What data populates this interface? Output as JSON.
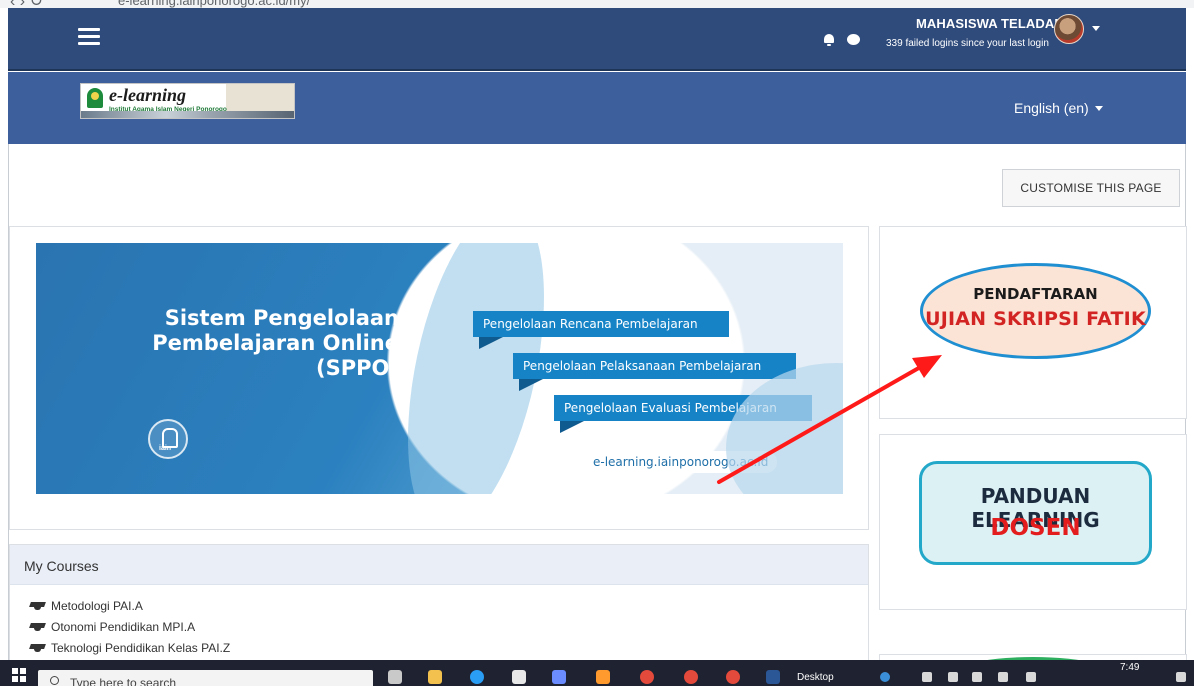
{
  "browser": {
    "url": "e-learning.iainponorogo.ac.id/my/"
  },
  "navbar": {
    "user_name": "MAHASISWA TELADAN",
    "failed_logins": "339 failed logins since your last login"
  },
  "header": {
    "logo_title": "e-learning",
    "logo_subtitle": "Institut Agama Islam Negeri Ponorogo",
    "language": "English (en)"
  },
  "page": {
    "customise_label": "CUSTOMISE THIS PAGE"
  },
  "banner": {
    "title_lines": [
      "Sistem Pengelolaan",
      "Pembelajaran Online",
      "(SPPO)"
    ],
    "tags": [
      "Pengelolaan Rencana Pembelajaran",
      "Pengelolaan Pelaksanaan Pembelajaran",
      "Pengelolaan Evaluasi Pembelajaran"
    ],
    "url": "e-learning.iainponorogo.ac.id"
  },
  "courses": {
    "heading": "My Courses",
    "items": [
      "Metodologi PAI.A",
      "Otonomi Pendidikan MPI.A",
      "Teknologi Pendidikan Kelas PAI.Z"
    ]
  },
  "side": {
    "registration_line1": "PENDAFTARAN",
    "registration_line2": "UJIAN SKRIPSI FATIK",
    "guide_line1": "PANDUAN ELEARNING",
    "guide_line2": "DOSEN"
  },
  "taskbar": {
    "search_placeholder": "Type here to search",
    "desktop_label": "Desktop",
    "time": "7:49"
  },
  "colors": {
    "navbar": "#2f4b7c",
    "header_band": "#3d5f9c",
    "annotation_arrow": "#ff1a1a"
  }
}
